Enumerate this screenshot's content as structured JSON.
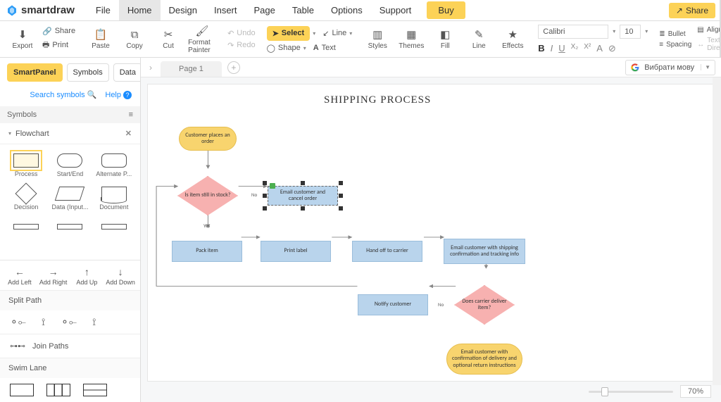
{
  "app": {
    "brand": "smartdraw"
  },
  "menu": {
    "items": [
      "File",
      "Home",
      "Design",
      "Insert",
      "Page",
      "Table",
      "Options",
      "Support"
    ],
    "active": 1,
    "buy": "Buy",
    "share": "Share"
  },
  "ribbon": {
    "export": "Export",
    "share": "Share",
    "print": "Print",
    "paste": "Paste",
    "copy": "Copy",
    "cut": "Cut",
    "format_painter": "Format Painter",
    "undo": "Undo",
    "redo": "Redo",
    "select": "Select",
    "line": "Line",
    "shape": "Shape",
    "text": "Text",
    "styles": "Styles",
    "themes": "Themes",
    "fill": "Fill",
    "line2": "Line",
    "effects": "Effects",
    "font_name": "Calibri",
    "font_size": "10",
    "bullet": "Bullet",
    "align": "Align",
    "spacing": "Spacing",
    "text_direction": "Text Direction"
  },
  "pages": {
    "page1": "Page 1",
    "lang": "Вибрати мову"
  },
  "leftpane": {
    "tabs": [
      "SmartPanel",
      "Symbols",
      "Data"
    ],
    "active": 0,
    "search": "Search symbols",
    "help": "Help",
    "section": "Symbols",
    "category": "Flowchart",
    "shapes": [
      "Process",
      "Start/End",
      "Alternate P...",
      "Decision",
      "Data (Input...",
      "Document"
    ],
    "add": [
      "Add Left",
      "Add Right",
      "Add Up",
      "Add Down"
    ],
    "split": "Split Path",
    "join": "Join Paths",
    "swim": "Swim Lane"
  },
  "flow": {
    "title": "SHIPPING PROCESS",
    "n_start": "Customer places an order",
    "n_stock": "Is item still in stock?",
    "n_email_cancel": "Email customer and cancel order",
    "n_pack": "Pack item",
    "n_print": "Print label",
    "n_handoff": "Hand off to carrier",
    "n_email_track": "Email customer with shipping confirmation and tracking info",
    "n_deliver": "Does carrier deliver item?",
    "n_notify": "Notify customer",
    "n_end": "Email customer with confirmation of delivery and optional return instructions",
    "yes": "Yes",
    "no": "No",
    "no2": "No"
  },
  "zoom": {
    "value": "70%"
  }
}
